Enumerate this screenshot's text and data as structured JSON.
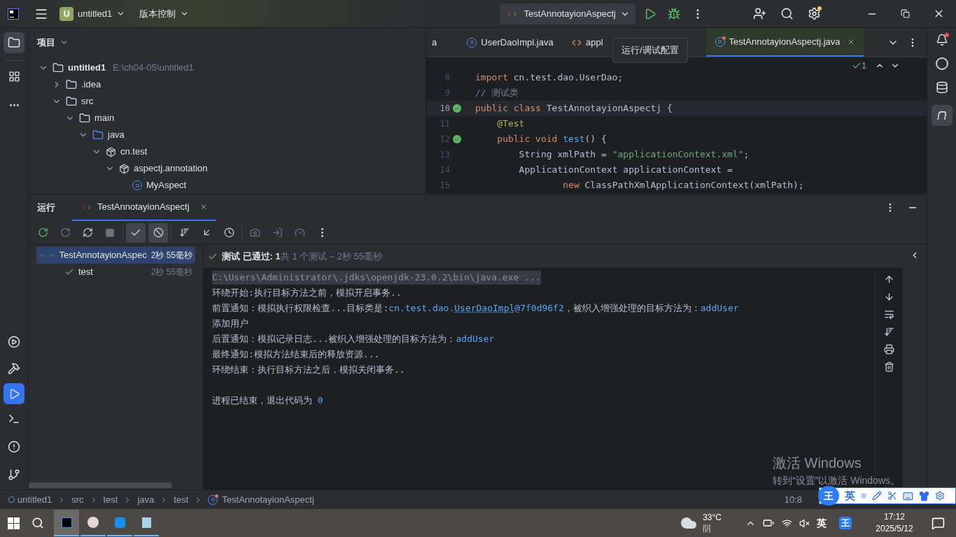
{
  "title_bar": {
    "project_badge": "U",
    "project": "untitled1",
    "vcs": "版本控制",
    "run_config": "TestAnnotayionAspectj"
  },
  "project_panel": {
    "title": "项目",
    "tree": [
      {
        "label": "untitled1",
        "hint": "E:\\ch04-05\\untitled1",
        "kind": "module",
        "expanded": true,
        "children": [
          {
            "label": ".idea",
            "kind": "folder",
            "expanded": false
          },
          {
            "label": "src",
            "kind": "folder",
            "expanded": true,
            "children": [
              {
                "label": "main",
                "kind": "folder",
                "expanded": true,
                "children": [
                  {
                    "label": "java",
                    "kind": "source",
                    "expanded": true,
                    "children": [
                      {
                        "label": "cn.test",
                        "kind": "package",
                        "expanded": true,
                        "children": [
                          {
                            "label": "aspectj.annotation",
                            "kind": "package",
                            "expanded": true,
                            "children": [
                              {
                                "label": "MyAspect",
                                "kind": "class"
                              }
                            ]
                          }
                        ]
                      }
                    ]
                  }
                ]
              }
            ]
          }
        ]
      }
    ]
  },
  "editor": {
    "tabs": [
      {
        "label": "a",
        "kind": "plain",
        "selected": false
      },
      {
        "label": "UserDaoImpl.java",
        "kind": "class",
        "selected": false
      },
      {
        "label": "appl",
        "kind": "xml",
        "selected": false
      },
      {
        "label": "TestAnnotayionAspectj.java",
        "kind": "test",
        "selected": true
      }
    ],
    "tooltip": "运行/调试配置",
    "inspections": "1",
    "lines": [
      {
        "number": "8",
        "current": false,
        "gutter": false,
        "segments": [
          {
            "text": "import ",
            "kind": "kw"
          },
          {
            "text": "cn.test.dao.UserDao;",
            "kind": "plain"
          }
        ]
      },
      {
        "number": "9",
        "current": false,
        "gutter": false,
        "segments": [
          {
            "text": "// 测试类",
            "kind": "comment"
          }
        ]
      },
      {
        "number": "10",
        "current": true,
        "gutter": true,
        "segments": [
          {
            "text": "public class ",
            "kind": "kw"
          },
          {
            "text": "TestAnnotayionAspectj {",
            "kind": "plain"
          }
        ]
      },
      {
        "number": "11",
        "current": false,
        "gutter": false,
        "segments": [
          {
            "text": "    @Test",
            "kind": "ann"
          }
        ]
      },
      {
        "number": "12",
        "current": false,
        "gutter": true,
        "segments": [
          {
            "text": "    public void ",
            "kind": "kw"
          },
          {
            "text": "test",
            "kind": "fn"
          },
          {
            "text": "() {",
            "kind": "plain"
          }
        ]
      },
      {
        "number": "13",
        "current": false,
        "gutter": false,
        "segments": [
          {
            "text": "        String xmlPath = ",
            "kind": "plain"
          },
          {
            "text": "\"applicationContext.xml\"",
            "kind": "str"
          },
          {
            "text": ";",
            "kind": "plain"
          }
        ]
      },
      {
        "number": "14",
        "current": false,
        "gutter": false,
        "segments": [
          {
            "text": "        ApplicationContext applicationContext =",
            "kind": "plain"
          }
        ]
      },
      {
        "number": "15",
        "current": false,
        "gutter": false,
        "segments": [
          {
            "text": "                new ",
            "kind": "kw"
          },
          {
            "text": "ClassPathXmlApplicationContext(xmlPath);",
            "kind": "plain"
          }
        ]
      }
    ]
  },
  "run_panel": {
    "title": "运行",
    "tab": "TestAnnotayionAspectj",
    "tests": [
      {
        "label": "TestAnnotayionAspec",
        "time": "2秒 55毫秒",
        "selected": true,
        "children": [
          {
            "label": "test",
            "time": "2秒 55毫秒",
            "selected": false
          }
        ]
      }
    ],
    "passed": "测试 已通过: 1",
    "summary": "共 1 个测试 – 2秒 55毫秒",
    "console": [
      {
        "kind": "command",
        "text": "C:\\Users\\Administrator\\.jdks\\openjdk-23.0.2\\bin\\java.exe ..."
      },
      {
        "kind": "text",
        "segments": [
          {
            "text": "环绕开始:执行目标方法之前，模拟开启事务..",
            "kind": "plain"
          }
        ]
      },
      {
        "kind": "text",
        "segments": [
          {
            "text": "前置通知：模拟执行权限检查...目标类是:",
            "kind": "plain"
          },
          {
            "text": "cn.test.dao.",
            "kind": "link"
          },
          {
            "text": "UserDaoImpl",
            "kind": "linkname"
          },
          {
            "text": "@7f0d96f2",
            "kind": "link"
          },
          {
            "text": "，被织入增强处理的目标方法为：",
            "kind": "plain"
          },
          {
            "text": "addUser",
            "kind": "link"
          }
        ]
      },
      {
        "kind": "text",
        "segments": [
          {
            "text": "添加用户",
            "kind": "plain"
          }
        ]
      },
      {
        "kind": "text",
        "segments": [
          {
            "text": "后置通知：模拟记录日志...被织入增强处理的目标方法为：",
            "kind": "plain"
          },
          {
            "text": "addUser",
            "kind": "link"
          }
        ]
      },
      {
        "kind": "text",
        "segments": [
          {
            "text": "最终通知:模拟方法结束后的释放资源...",
            "kind": "plain"
          }
        ]
      },
      {
        "kind": "text",
        "segments": [
          {
            "text": "环绕结束：执行目标方法之后，模拟关闭事务..",
            "kind": "plain"
          }
        ]
      },
      {
        "kind": "blank"
      },
      {
        "kind": "text",
        "segments": [
          {
            "text": "进程已结束，退出代码为 ",
            "kind": "plain"
          },
          {
            "text": "0",
            "kind": "link"
          }
        ]
      }
    ]
  },
  "status_bar": {
    "breadcrumbs": [
      {
        "label": "untitled1",
        "kind": "module"
      },
      {
        "label": "src",
        "kind": "plain"
      },
      {
        "label": "test",
        "kind": "plain"
      },
      {
        "label": "java",
        "kind": "plain"
      },
      {
        "label": "test",
        "kind": "plain"
      },
      {
        "label": "TestAnnotayionAspectj",
        "kind": "test"
      }
    ],
    "position": "10:8"
  },
  "activation": {
    "title": "激活 Windows",
    "text": "转到“设置”以激活 Windows。"
  },
  "ime_bar": {
    "badge": "王",
    "mode": "英"
  },
  "taskbar": {
    "temperature": "33°C",
    "weather": "阴",
    "ime": "英",
    "ime_badge": "王",
    "time": "17:12",
    "date": "2025/5/12"
  }
}
